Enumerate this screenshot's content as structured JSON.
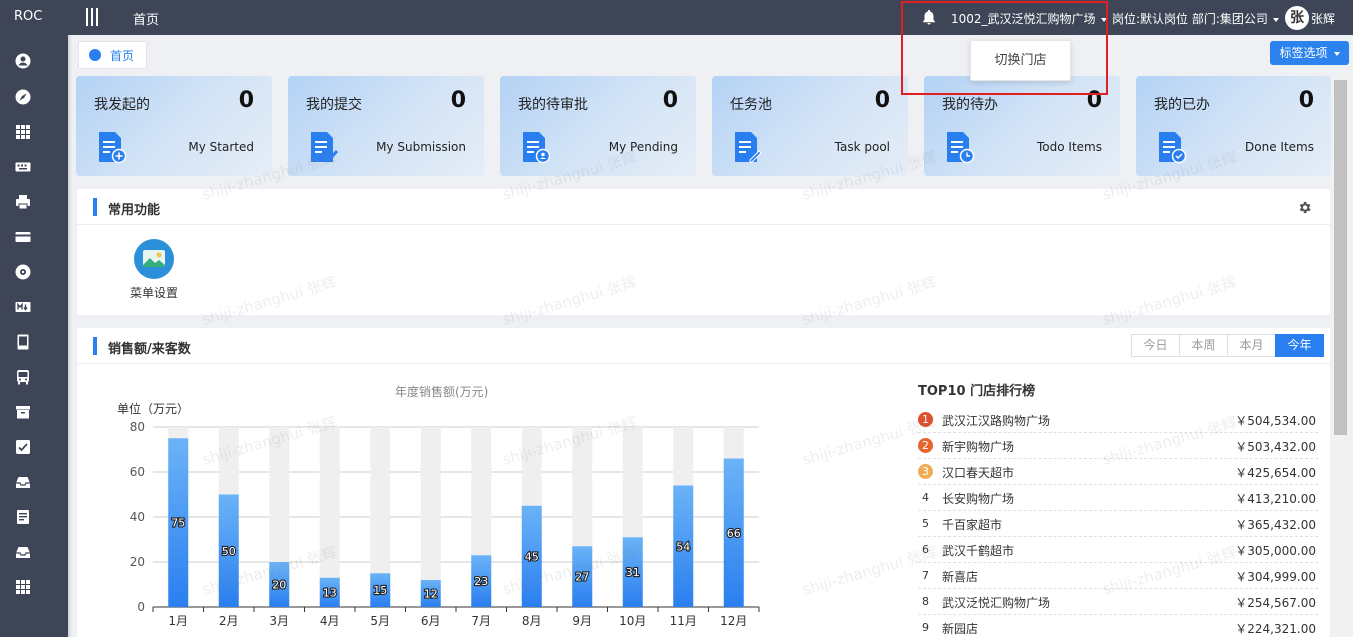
{
  "topbar": {
    "brand": "ROC",
    "home": "首页",
    "store": "1002_武汉泛悦汇购物广场",
    "post_info": "岗位:默认岗位 部门:集团公司",
    "avatar_char": "张",
    "username": "张辉"
  },
  "store_dropdown": {
    "item": "切换门店"
  },
  "tabs": {
    "home": "首页",
    "options": "标签选项"
  },
  "cards": [
    {
      "title": "我发起的",
      "count": "0",
      "en": "My Started",
      "icon": "doc-add-icon"
    },
    {
      "title": "我的提交",
      "count": "0",
      "en": "My Submission",
      "icon": "doc-check-icon"
    },
    {
      "title": "我的待审批",
      "count": "0",
      "en": "My Pending",
      "icon": "doc-user-icon"
    },
    {
      "title": "任务池",
      "count": "0",
      "en": "Task pool",
      "icon": "doc-edit-icon"
    },
    {
      "title": "我的待办",
      "count": "0",
      "en": "Todo Items",
      "icon": "doc-clock-icon"
    },
    {
      "title": "我的已办",
      "count": "0",
      "en": "Done Items",
      "icon": "doc-done-icon"
    }
  ],
  "common_functions": {
    "title": "常用功能",
    "items": [
      {
        "label": "菜单设置",
        "icon": "picture-icon"
      }
    ]
  },
  "sales": {
    "title": "销售额/来客数",
    "periods": [
      "今日",
      "本周",
      "本月",
      "今年"
    ],
    "active_period": "今年",
    "chart_title": "年度销售额(万元)",
    "unit_label": "单位（万元）",
    "top10_title": "TOP10 门店排行榜",
    "ranking": [
      {
        "rank": "1",
        "name": "武汉江汉路购物广场",
        "value": "￥504,534.00"
      },
      {
        "rank": "2",
        "name": "新宇购物广场",
        "value": "￥503,432.00"
      },
      {
        "rank": "3",
        "name": "汉口春天超市",
        "value": "￥425,654.00"
      },
      {
        "rank": "4",
        "name": "长安购物广场",
        "value": "￥413,210.00"
      },
      {
        "rank": "5",
        "name": "千百家超市",
        "value": "￥365,432.00"
      },
      {
        "rank": "6",
        "name": "武汉千鹤超市",
        "value": "￥305,000.00"
      },
      {
        "rank": "7",
        "name": "新喜店",
        "value": "￥304,999.00"
      },
      {
        "rank": "8",
        "name": "武汉泛悦汇购物广场",
        "value": "￥254,567.00"
      },
      {
        "rank": "9",
        "name": "新园店",
        "value": "￥224,321.00"
      }
    ],
    "rank_colors": [
      "#e04f2e",
      "#e8642f",
      "#f0ab57"
    ]
  },
  "watermark": "shiji-zhanghui 张辉",
  "chart_data": {
    "type": "bar",
    "title": "年度销售额(万元)",
    "ylabel": "单位（万元）",
    "categories": [
      "1月",
      "2月",
      "3月",
      "4月",
      "5月",
      "6月",
      "7月",
      "8月",
      "9月",
      "10月",
      "11月",
      "12月"
    ],
    "values": [
      75,
      50,
      20,
      13,
      15,
      12,
      23,
      45,
      27,
      31,
      54,
      66
    ],
    "background_bar_value": 80,
    "ylim": [
      0,
      80
    ],
    "yticks": [
      0,
      20,
      40,
      60,
      80
    ],
    "bar_color": "#2a7ff0",
    "grid": true
  }
}
